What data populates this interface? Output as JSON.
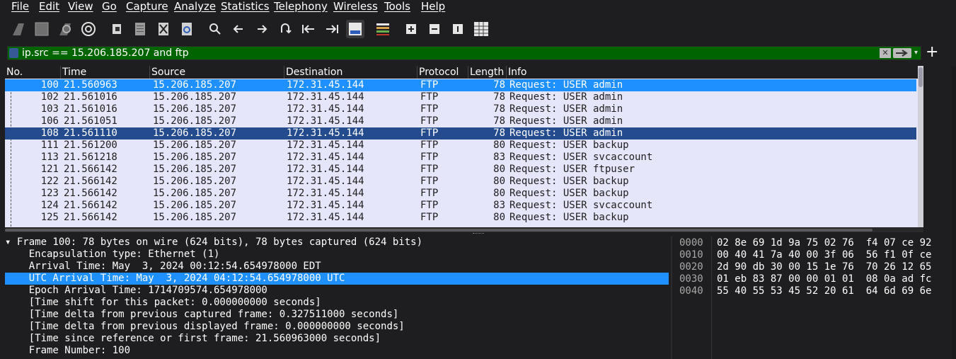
{
  "menu": [
    "File",
    "Edit",
    "View",
    "Go",
    "Capture",
    "Analyze",
    "Statistics",
    "Telephony",
    "Wireless",
    "Tools",
    "Help"
  ],
  "filter": {
    "value": "ip.src == 15.206.185.207 and ftp",
    "clear_glyph": "✕",
    "dropdown_glyph": "▾",
    "add_glyph": "+"
  },
  "columns": [
    "No.",
    "Time",
    "Source",
    "Destination",
    "Protocol",
    "Length",
    "Info"
  ],
  "packets": [
    {
      "no": "100",
      "time": "21.560963",
      "src": "15.206.185.207",
      "dst": "172.31.45.144",
      "proto": "FTP",
      "len": "78",
      "info": "Request: USER admin"
    },
    {
      "no": "102",
      "time": "21.561016",
      "src": "15.206.185.207",
      "dst": "172.31.45.144",
      "proto": "FTP",
      "len": "78",
      "info": "Request: USER admin"
    },
    {
      "no": "103",
      "time": "21.561016",
      "src": "15.206.185.207",
      "dst": "172.31.45.144",
      "proto": "FTP",
      "len": "78",
      "info": "Request: USER admin"
    },
    {
      "no": "106",
      "time": "21.561051",
      "src": "15.206.185.207",
      "dst": "172.31.45.144",
      "proto": "FTP",
      "len": "78",
      "info": "Request: USER admin"
    },
    {
      "no": "108",
      "time": "21.561110",
      "src": "15.206.185.207",
      "dst": "172.31.45.144",
      "proto": "FTP",
      "len": "78",
      "info": "Request: USER admin"
    },
    {
      "no": "111",
      "time": "21.561200",
      "src": "15.206.185.207",
      "dst": "172.31.45.144",
      "proto": "FTP",
      "len": "80",
      "info": "Request: USER backup"
    },
    {
      "no": "113",
      "time": "21.561218",
      "src": "15.206.185.207",
      "dst": "172.31.45.144",
      "proto": "FTP",
      "len": "83",
      "info": "Request: USER svcaccount"
    },
    {
      "no": "121",
      "time": "21.566142",
      "src": "15.206.185.207",
      "dst": "172.31.45.144",
      "proto": "FTP",
      "len": "80",
      "info": "Request: USER ftpuser"
    },
    {
      "no": "122",
      "time": "21.566142",
      "src": "15.206.185.207",
      "dst": "172.31.45.144",
      "proto": "FTP",
      "len": "80",
      "info": "Request: USER backup"
    },
    {
      "no": "123",
      "time": "21.566142",
      "src": "15.206.185.207",
      "dst": "172.31.45.144",
      "proto": "FTP",
      "len": "80",
      "info": "Request: USER backup"
    },
    {
      "no": "124",
      "time": "21.566142",
      "src": "15.206.185.207",
      "dst": "172.31.45.144",
      "proto": "FTP",
      "len": "83",
      "info": "Request: USER svcaccount"
    },
    {
      "no": "125",
      "time": "21.566142",
      "src": "15.206.185.207",
      "dst": "172.31.45.144",
      "proto": "FTP",
      "len": "80",
      "info": "Request: USER backup"
    }
  ],
  "details": [
    {
      "text": "▾ Frame 100: 78 bytes on wire (624 bits), 78 bytes captured (624 bits)"
    },
    {
      "text": "    Encapsulation type: Ethernet (1)"
    },
    {
      "text": "    Arrival Time: May  3, 2024 00:12:54.654978000 EDT"
    },
    {
      "text": "    UTC Arrival Time: May  3, 2024 04:12:54.654978000 UTC"
    },
    {
      "text": "    Epoch Arrival Time: 1714709574.654978000"
    },
    {
      "text": "    [Time shift for this packet: 0.000000000 seconds]"
    },
    {
      "text": "    [Time delta from previous captured frame: 0.327511000 seconds]"
    },
    {
      "text": "    [Time delta from previous displayed frame: 0.000000000 seconds]"
    },
    {
      "text": "    [Time since reference or first frame: 21.560963000 seconds]"
    },
    {
      "text": "    Frame Number: 100"
    }
  ],
  "bytes": [
    {
      "offset": "0000",
      "hex": "02 8e 69 1d 9a 75 02 76  f4 07 ce 92"
    },
    {
      "offset": "0010",
      "hex": "00 40 41 7a 40 00 3f 06  56 f1 0f ce"
    },
    {
      "offset": "0020",
      "hex": "2d 90 db 30 00 15 1e 76  70 26 12 65"
    },
    {
      "offset": "0030",
      "hex": "01 eb 83 87 00 00 01 01  08 0a ad fc"
    },
    {
      "offset": "0040",
      "hex": "55 40 55 53 45 52 20 61  64 6d 69 6e"
    }
  ],
  "colors": {
    "selected_row": "#1e90ff",
    "marked_row": "#244b8e",
    "list_bg": "#e6e6fa",
    "filter_bg": "#006400"
  }
}
